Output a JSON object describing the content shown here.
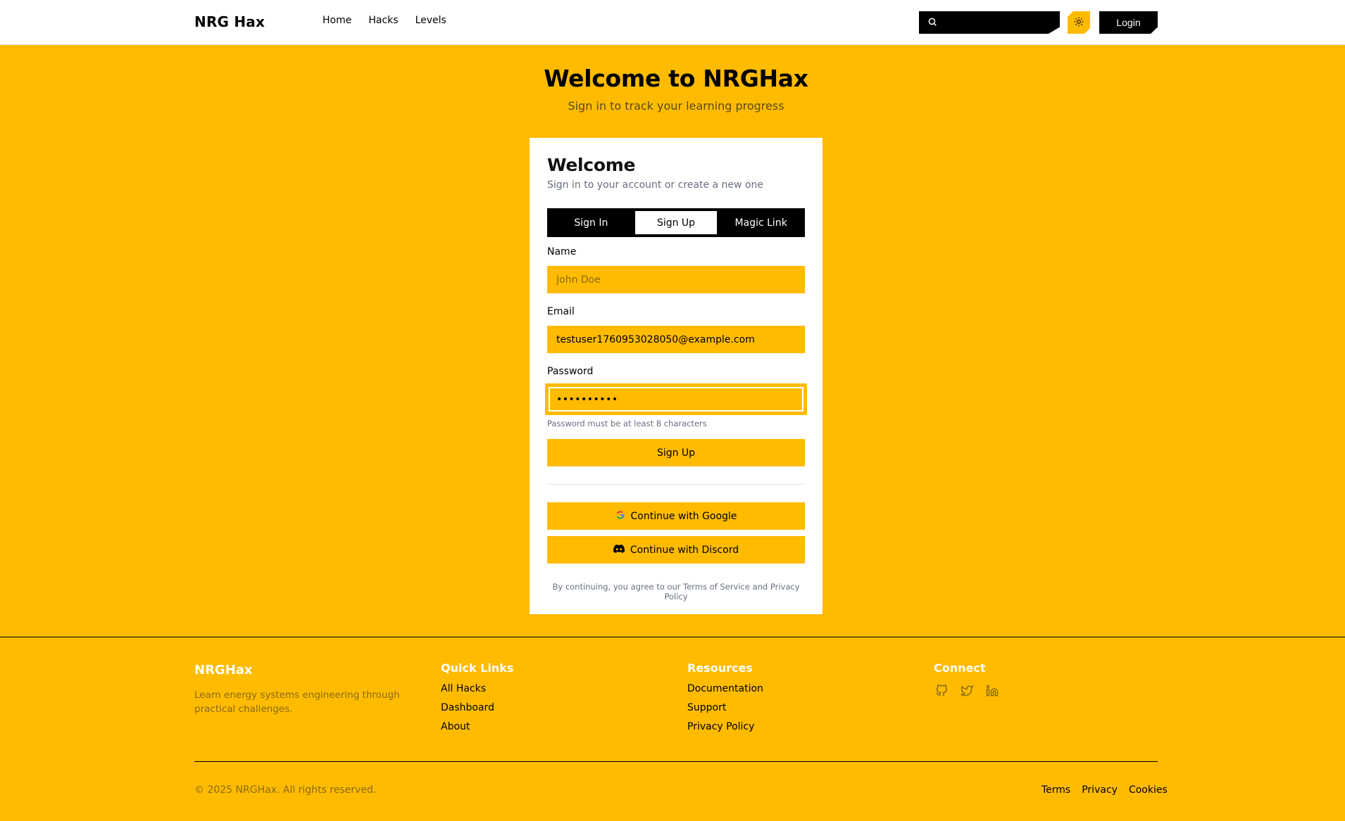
{
  "header": {
    "brand": "NRG Hax",
    "nav": [
      {
        "label": "Home"
      },
      {
        "label": "Hacks"
      },
      {
        "label": "Levels"
      }
    ],
    "search": {
      "value": "",
      "placeholder": ""
    },
    "theme_icon": "sun-icon",
    "login_label": "Login"
  },
  "hero": {
    "title": "Welcome to NRGHax",
    "subtitle": "Sign in to track your learning progress"
  },
  "card": {
    "title": "Welcome",
    "subtitle": "Sign in to your account or create a new one",
    "tabs": [
      {
        "label": "Sign In",
        "active": false
      },
      {
        "label": "Sign Up",
        "active": true
      },
      {
        "label": "Magic Link",
        "active": false
      }
    ],
    "fields": {
      "name": {
        "label": "Name",
        "value": "",
        "placeholder": "John Doe"
      },
      "email": {
        "label": "Email",
        "value": "testuser1760953028050@example.com",
        "placeholder": ""
      },
      "password": {
        "label": "Password",
        "value": "••••••••••",
        "placeholder": ""
      }
    },
    "password_hint": "Password must be at least 8 characters",
    "submit_label": "Sign Up",
    "google_label": "Continue with Google",
    "discord_label": "Continue with Discord",
    "terms": "By continuing, you agree to our Terms of Service and Privacy Policy"
  },
  "footer": {
    "brand": "NRGHax",
    "description": "Learn energy systems engineering through practical challenges.",
    "quick_links": {
      "title": "Quick Links",
      "items": [
        "All Hacks",
        "Dashboard",
        "About"
      ]
    },
    "resources": {
      "title": "Resources",
      "items": [
        "Documentation",
        "Support",
        "Privacy Policy"
      ]
    },
    "connect": {
      "title": "Connect",
      "icons": [
        "github-icon",
        "twitter-icon",
        "linkedin-icon"
      ]
    },
    "copyright": "© 2025 NRGHax. All rights reserved.",
    "legal": [
      "Terms",
      "Privacy",
      "Cookies"
    ]
  },
  "colors": {
    "accent": "#FFBB00",
    "dark": "#000000",
    "muted": "#666e80"
  }
}
